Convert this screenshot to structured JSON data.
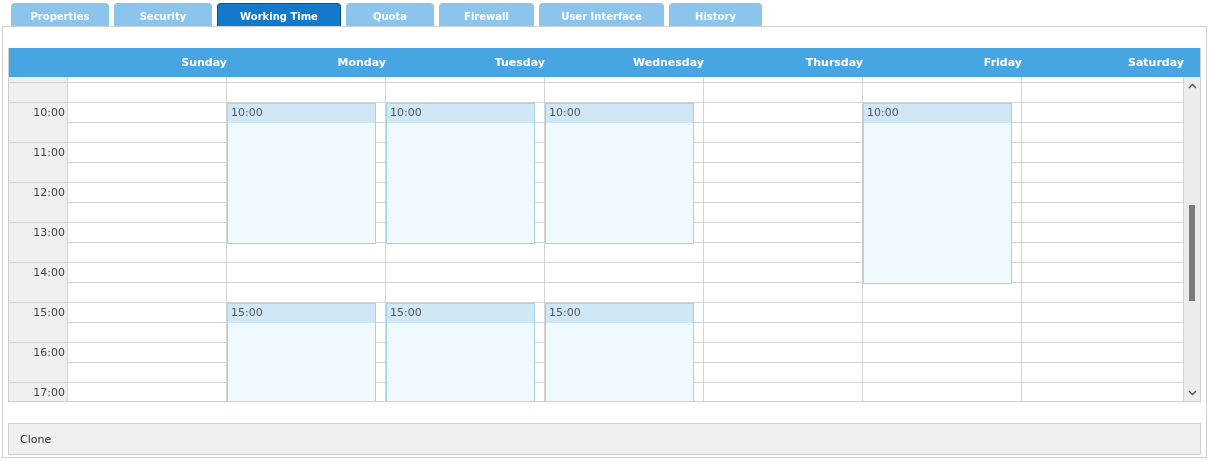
{
  "tabs": [
    {
      "label": "Properties",
      "selected": false
    },
    {
      "label": "Security",
      "selected": false
    },
    {
      "label": "Working Time",
      "selected": true
    },
    {
      "label": "Quota",
      "selected": false
    },
    {
      "label": "Firewall",
      "selected": false
    },
    {
      "label": "User Interface",
      "selected": false
    },
    {
      "label": "History",
      "selected": false
    }
  ],
  "calendar": {
    "days": [
      "Sunday",
      "Monday",
      "Tuesday",
      "Wednesday",
      "Thursday",
      "Friday",
      "Saturday"
    ],
    "rows": [
      {
        "cells": [
          {
            "booked": false
          },
          {
            "booked": false
          },
          {
            "booked": false
          },
          {
            "booked": false
          },
          {
            "booked": false
          },
          {
            "booked": false
          },
          {
            "booked": false
          }
        ]
      },
      {
        "cells": [
          {
            "booked": false
          },
          {
            "booked": false
          },
          {
            "booked": false
          },
          {
            "booked": false
          },
          {
            "booked": false
          },
          {
            "booked": false
          },
          {
            "booked": false
          }
        ]
      },
      {
        "label": "10:00",
        "cells": [
          {
            "booked": false
          },
          {
            "booked": true,
            "title": "10:00"
          },
          {
            "booked": true,
            "title": "10:00"
          },
          {
            "booked": true,
            "title": "10:00"
          },
          {
            "booked": false
          },
          {
            "booked": true,
            "title": "10:00"
          },
          {
            "booked": false
          }
        ]
      },
      {
        "cells": [
          {
            "booked": false
          },
          {
            "booked": true
          },
          {
            "booked": true
          },
          {
            "booked": true
          },
          {
            "booked": false
          },
          {
            "booked": true
          },
          {
            "booked": false
          }
        ]
      },
      {
        "label": "11:00",
        "cells": [
          {
            "booked": false
          },
          {
            "booked": true
          },
          {
            "booked": true
          },
          {
            "booked": true
          },
          {
            "booked": false
          },
          {
            "booked": true
          },
          {
            "booked": false
          }
        ]
      },
      {
        "cells": [
          {
            "booked": false
          },
          {
            "booked": true
          },
          {
            "booked": true
          },
          {
            "booked": true
          },
          {
            "booked": false
          },
          {
            "booked": true
          },
          {
            "booked": false
          }
        ]
      },
      {
        "label": "12:00",
        "cells": [
          {
            "booked": false
          },
          {
            "booked": true
          },
          {
            "booked": true
          },
          {
            "booked": true
          },
          {
            "booked": false
          },
          {
            "booked": true
          },
          {
            "booked": false
          }
        ]
      },
      {
        "cells": [
          {
            "booked": false
          },
          {
            "booked": true
          },
          {
            "booked": true
          },
          {
            "booked": true
          },
          {
            "booked": false
          },
          {
            "booked": true
          },
          {
            "booked": false
          }
        ]
      },
      {
        "label": "13:00",
        "cells": [
          {
            "booked": false
          },
          {
            "booked": true
          },
          {
            "booked": true
          },
          {
            "booked": true
          },
          {
            "booked": false
          },
          {
            "booked": true
          },
          {
            "booked": false
          }
        ]
      },
      {
        "cells": [
          {
            "booked": false
          },
          {
            "booked": false
          },
          {
            "booked": false
          },
          {
            "booked": false
          },
          {
            "booked": false
          },
          {
            "booked": true
          },
          {
            "booked": false
          }
        ]
      },
      {
        "label": "14:00",
        "cells": [
          {
            "booked": false
          },
          {
            "booked": false
          },
          {
            "booked": false
          },
          {
            "booked": false
          },
          {
            "booked": false
          },
          {
            "booked": true
          },
          {
            "booked": false
          }
        ]
      },
      {
        "cells": [
          {
            "booked": false
          },
          {
            "booked": false
          },
          {
            "booked": false
          },
          {
            "booked": false
          },
          {
            "booked": false
          },
          {
            "booked": false
          },
          {
            "booked": false
          }
        ]
      },
      {
        "label": "15:00",
        "cells": [
          {
            "booked": false
          },
          {
            "booked": true,
            "title": "15:00"
          },
          {
            "booked": true,
            "title": "15:00"
          },
          {
            "booked": true,
            "title": "15:00"
          },
          {
            "booked": false
          },
          {
            "booked": false
          },
          {
            "booked": false
          }
        ]
      },
      {
        "cells": [
          {
            "booked": false
          },
          {
            "booked": true
          },
          {
            "booked": true
          },
          {
            "booked": true
          },
          {
            "booked": false
          },
          {
            "booked": false
          },
          {
            "booked": false
          }
        ]
      },
      {
        "label": "16:00",
        "cells": [
          {
            "booked": false
          },
          {
            "booked": true
          },
          {
            "booked": true
          },
          {
            "booked": true
          },
          {
            "booked": false
          },
          {
            "booked": false
          },
          {
            "booked": false
          }
        ]
      },
      {
        "cells": [
          {
            "booked": false
          },
          {
            "booked": true
          },
          {
            "booked": true
          },
          {
            "booked": true
          },
          {
            "booked": false
          },
          {
            "booked": false
          },
          {
            "booked": false
          }
        ]
      },
      {
        "label": "17:00",
        "cells": [
          {
            "booked": false
          },
          {
            "booked": true
          },
          {
            "booked": true
          },
          {
            "booked": true
          },
          {
            "booked": false
          },
          {
            "booked": false
          },
          {
            "booked": false
          }
        ]
      }
    ]
  },
  "footer": {
    "label": "Clone"
  }
}
